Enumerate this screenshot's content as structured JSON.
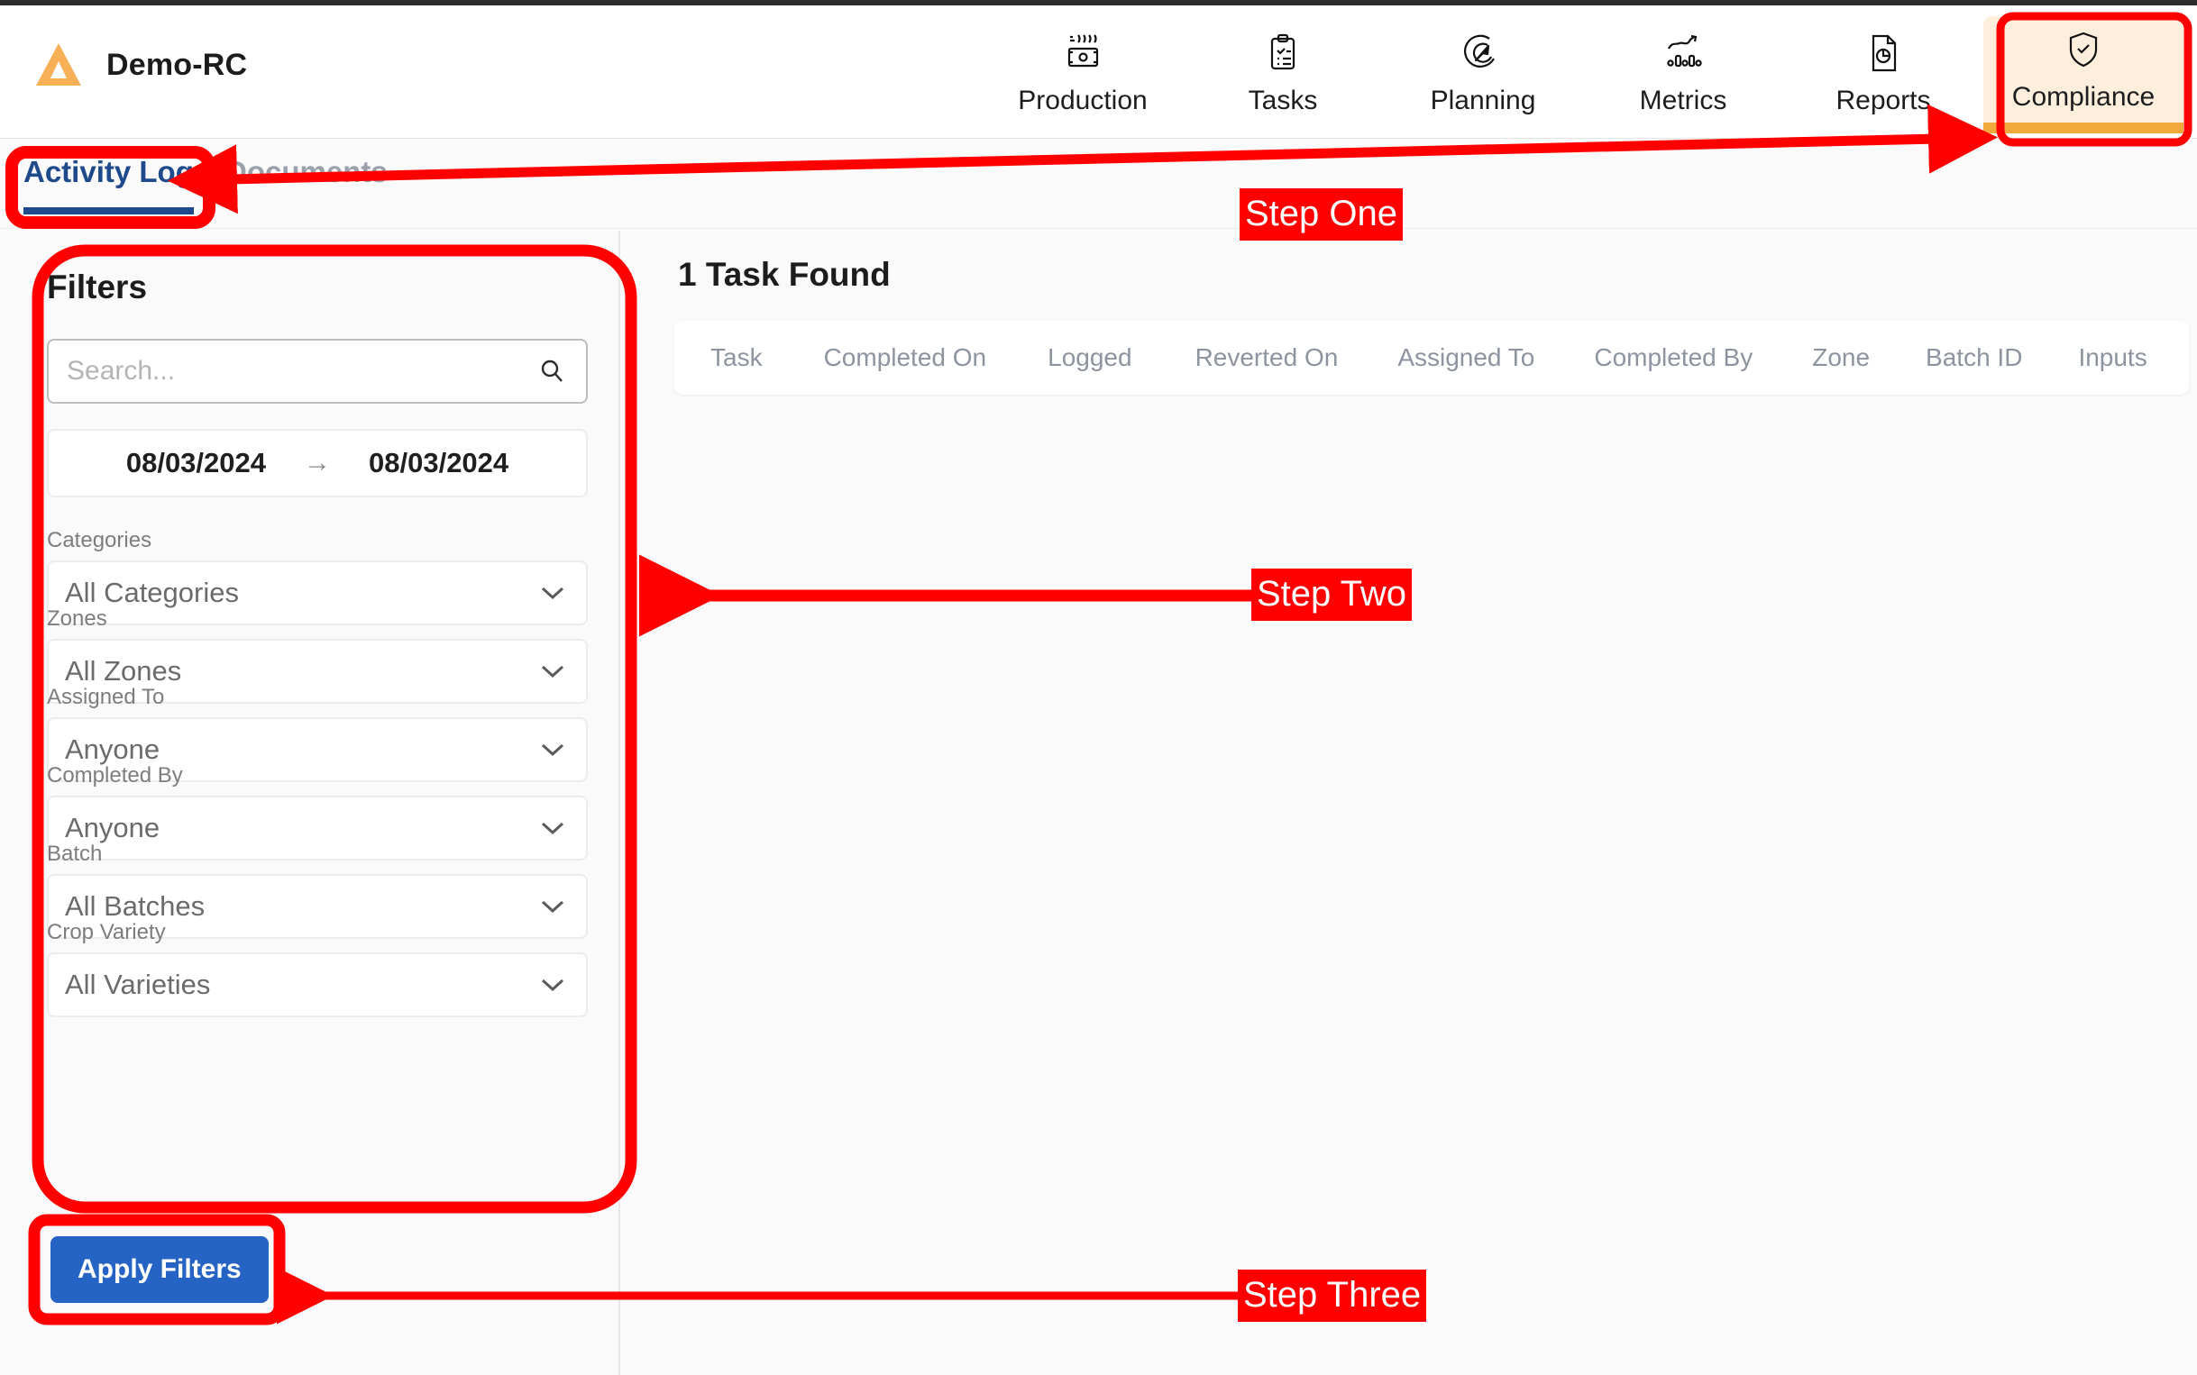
{
  "app": {
    "brand_name": "Demo-RC",
    "logo_icon": "triangle-logo",
    "logo_color": "#f7b055"
  },
  "nav": {
    "items": [
      {
        "label": "Production",
        "icon": "cash-production-icon",
        "active": false
      },
      {
        "label": "Tasks",
        "icon": "clipboard-check-icon",
        "active": false
      },
      {
        "label": "Planning",
        "icon": "target-cursor-icon",
        "active": false
      },
      {
        "label": "Metrics",
        "icon": "bar-chart-trend-icon",
        "active": false
      },
      {
        "label": "Reports",
        "icon": "document-chart-icon",
        "active": false
      },
      {
        "label": "Compliance",
        "icon": "shield-check-icon",
        "active": true
      }
    ],
    "active_bg": "#fdefdc",
    "active_accent": "#f2a93b"
  },
  "tabs": {
    "active": {
      "label": "Activity Log",
      "color": "#1e4a8c"
    },
    "inactive": {
      "label": "Documents",
      "color": "#9aa1ac"
    }
  },
  "sidebar": {
    "title": "Filters",
    "search": {
      "value": "",
      "placeholder": "Search...",
      "icon": "search-icon"
    },
    "date_range": {
      "start": "08/03/2024",
      "end": "08/03/2024",
      "arrow": "→"
    },
    "filters": [
      {
        "label": "Categories",
        "value": "All Categories"
      },
      {
        "label": "Zones",
        "value": "All Zones"
      },
      {
        "label": "Assigned To",
        "value": "Anyone"
      },
      {
        "label": "Completed By",
        "value": "Anyone"
      },
      {
        "label": "Batch",
        "value": "All Batches"
      },
      {
        "label": "Crop Variety",
        "value": "All Varieties"
      }
    ],
    "apply_button": {
      "label": "Apply Filters",
      "color": "#2563c4"
    }
  },
  "main": {
    "result_count": "1 Task Found",
    "table_headers": [
      "Task",
      "Completed On",
      "Logged",
      "Reverted On",
      "Assigned To",
      "Completed By",
      "Zone",
      "Batch ID",
      "Inputs"
    ],
    "rows": []
  },
  "annotations": {
    "color": "#ff0000",
    "steps": [
      {
        "label": "Step One"
      },
      {
        "label": "Step Two"
      },
      {
        "label": "Step Three"
      }
    ]
  }
}
